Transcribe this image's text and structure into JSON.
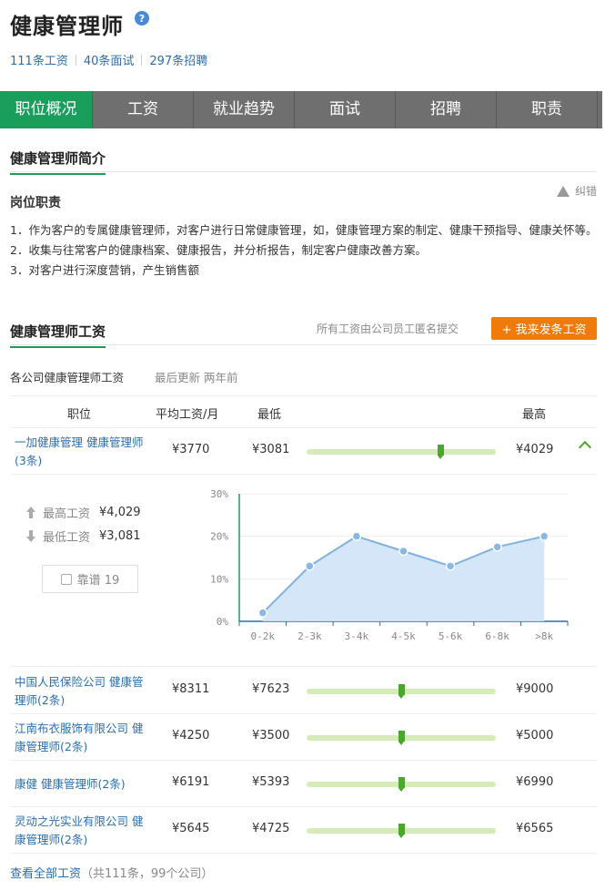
{
  "header": {
    "title": "健康管理师",
    "help_icon": "question-icon",
    "stats": [
      "111条工资",
      "40条面试",
      "297条招聘"
    ]
  },
  "tabs": [
    "职位概况",
    "工资",
    "就业趋势",
    "面试",
    "招聘",
    "职责"
  ],
  "active_tab": 0,
  "intro": {
    "heading": "健康管理师简介",
    "duty_title": "岗位职责",
    "report_label": "纠错",
    "duties": [
      "1．作为客户的专属健康管理师，对客户进行日常健康管理，如，健康管理方案的制定、健康干预指导、健康关怀等。",
      "2．收集与往常客户的健康档案、健康报告，并分析报告，制定客户健康改善方案。",
      "3．对客户进行深度营销，产生销售额"
    ]
  },
  "salary": {
    "heading": "健康管理师工资",
    "note": "所有工资由公司员工匿名提交",
    "post_button": "+ 我来发条工资",
    "company_label": "各公司健康管理师工资",
    "updated": "最后更新  两年前",
    "columns": [
      "职位",
      "平均工资/月",
      "最低",
      "最高"
    ],
    "rows": [
      {
        "name": "一加健康管理 健康管理师(3条)",
        "avg": "¥3770",
        "min": "¥3081",
        "max": "¥4029",
        "level": 0.71
      },
      {
        "name": "中国人民保险公司 健康管理师(2条)",
        "avg": "¥8311",
        "min": "¥7623",
        "max": "¥9000",
        "level": 0.5
      },
      {
        "name": "江南布衣服饰有限公司 健康管理师(2条)",
        "avg": "¥4250",
        "min": "¥3500",
        "max": "¥5000",
        "level": 0.5
      },
      {
        "name": "康健 健康管理师(2条)",
        "avg": "¥6191",
        "min": "¥5393",
        "max": "¥6990",
        "level": 0.5
      },
      {
        "name": "灵动之光实业有限公司 健康管理师(2条)",
        "avg": "¥5645",
        "min": "¥4725",
        "max": "¥6565",
        "level": 0.5
      }
    ],
    "detail": {
      "max_label": "最高工资",
      "max_value": "¥4,029",
      "min_label": "最低工资",
      "min_value": "¥3,081",
      "like_label": "靠谱 19"
    },
    "footer_link": "查看全部工资",
    "footer_count": "（共111条，99个公司）"
  },
  "chart_data": {
    "type": "area",
    "categories": [
      "0-2k",
      "2-3k",
      "3-4k",
      "4-5k",
      "5-6k",
      "6-8k",
      ">8k"
    ],
    "values": [
      2,
      13,
      20,
      16.5,
      13,
      17.5,
      20
    ],
    "yticks": [
      "0%",
      "10%",
      "20%",
      "30%"
    ],
    "ylim": [
      0,
      30
    ],
    "colors": {
      "line": "#7fb2e0",
      "fill": "#cfe3f6",
      "point": "#8ab8e2"
    }
  }
}
